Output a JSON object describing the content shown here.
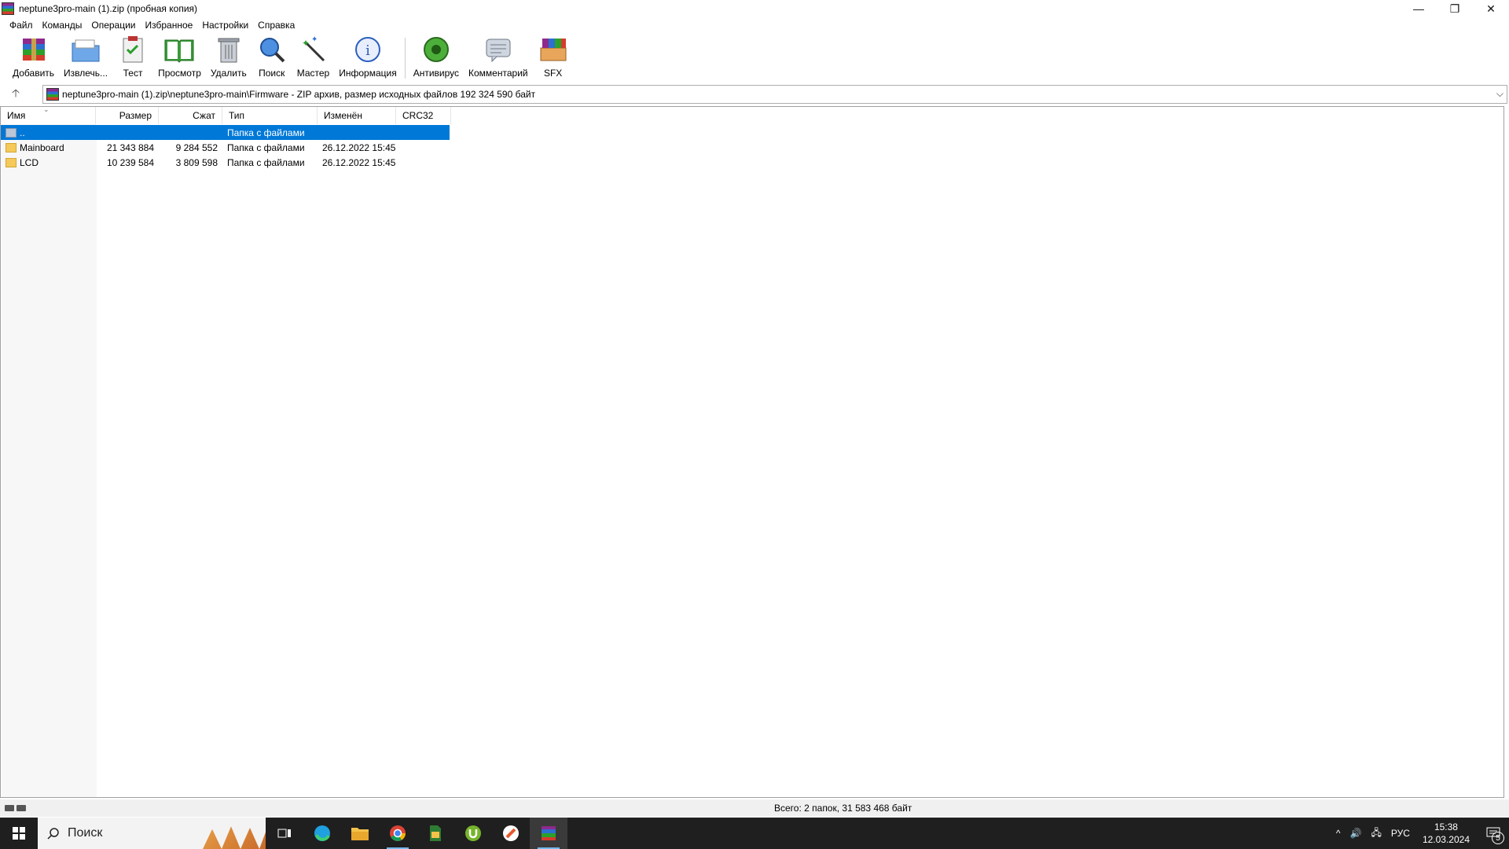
{
  "window": {
    "title": "neptune3pro-main (1).zip (пробная копия)",
    "controls": {
      "minimize": "—",
      "restore": "❐",
      "close": "✕"
    }
  },
  "menu": [
    "Файл",
    "Команды",
    "Операции",
    "Избранное",
    "Настройки",
    "Справка"
  ],
  "toolbar": {
    "buttons": [
      {
        "label": "Добавить",
        "icon": "archive-add-icon"
      },
      {
        "label": "Извлечь...",
        "icon": "extract-folder-icon"
      },
      {
        "label": "Тест",
        "icon": "test-clipboard-icon"
      },
      {
        "label": "Просмотр",
        "icon": "view-book-icon"
      },
      {
        "label": "Удалить",
        "icon": "trash-icon"
      },
      {
        "label": "Поиск",
        "icon": "magnifier-icon"
      },
      {
        "label": "Мастер",
        "icon": "wizard-wand-icon"
      },
      {
        "label": "Информация",
        "icon": "info-icon"
      },
      {
        "label": "Антивирус",
        "icon": "antivirus-icon"
      },
      {
        "label": "Комментарий",
        "icon": "comment-icon"
      },
      {
        "label": "SFX",
        "icon": "sfx-icon"
      }
    ]
  },
  "address": {
    "up_glyph": "🡡",
    "path": "neptune3pro-main (1).zip\\neptune3pro-main\\Firmware - ZIP архив, размер исходных файлов 192 324 590 байт",
    "dropdown": "⌵"
  },
  "columns": {
    "name": "Имя",
    "size": "Размер",
    "packed": "Сжат",
    "type": "Тип",
    "modified": "Изменён",
    "crc": "CRC32",
    "sort_glyph": "⌄"
  },
  "rows": [
    {
      "name": "..",
      "size": "",
      "packed": "",
      "type": "Папка с файлами",
      "modified": "",
      "selected": true
    },
    {
      "name": "Mainboard",
      "size": "21 343 884",
      "packed": "9 284 552",
      "type": "Папка с файлами",
      "modified": "26.12.2022 15:45",
      "selected": false
    },
    {
      "name": "LCD",
      "size": "10 239 584",
      "packed": "3 809 598",
      "type": "Папка с файлами",
      "modified": "26.12.2022 15:45",
      "selected": false
    }
  ],
  "status": {
    "total": "Всего: 2 папок, 31 583 468 байт"
  },
  "taskbar": {
    "search_placeholder": "Поиск",
    "tray": {
      "chevron": "^",
      "volume": "🔊",
      "network": "🖧",
      "lang": "РУС",
      "time": "15:38",
      "date": "12.03.2024",
      "notifications": "5"
    }
  },
  "colors": {
    "selection": "#0078d7",
    "taskbar": "#1f1f1f"
  }
}
